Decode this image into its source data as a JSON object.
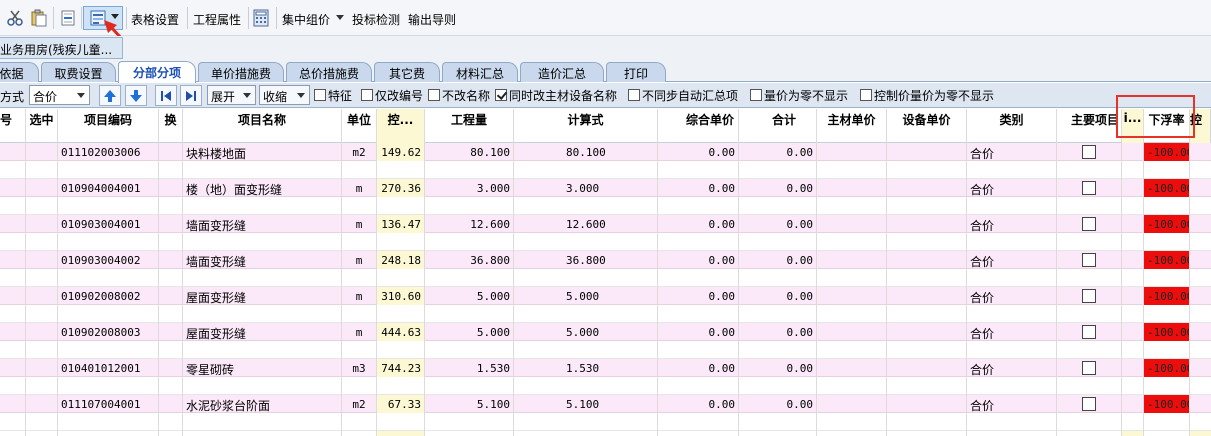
{
  "toolbar": {
    "buttons": [
      {
        "icon": "scissors-icon"
      },
      {
        "icon": "paste-icon"
      },
      {
        "icon": "insert-row-icon"
      },
      {
        "icon": "settings-panel-icon"
      }
    ],
    "table_settings": "表格设置",
    "project_attributes": "工程属性",
    "calculator_icon": "calculator-icon",
    "group_pricing": "集中组价",
    "bid_check": "投标检测",
    "export_wizard": "输出导则"
  },
  "file_tab": {
    "label": "业务用房(残疾儿童..."
  },
  "tabs": [
    {
      "label": "依据"
    },
    {
      "label": "取费设置"
    },
    {
      "label": "分部分项",
      "active": true
    },
    {
      "label": "单价措施费"
    },
    {
      "label": "总价措施费"
    },
    {
      "label": "其它费"
    },
    {
      "label": "材料汇总"
    },
    {
      "label": "造价汇总"
    },
    {
      "label": "打印"
    }
  ],
  "toolbar2": {
    "mode_label": "方式",
    "mode_value": "合价",
    "expand": "展开",
    "collapse": "收缩",
    "checkboxes": [
      {
        "label": "特征",
        "checked": false
      },
      {
        "label": "仅改编号",
        "checked": false
      },
      {
        "label": "不改名称",
        "checked": false
      },
      {
        "label": "同时改主材设备名称",
        "checked": true
      },
      {
        "label": "不同步自动汇总项",
        "checked": false
      },
      {
        "label": "量价为零不显示",
        "checked": false
      },
      {
        "label": "控制价量价为零不显示",
        "checked": false
      }
    ]
  },
  "grid": {
    "columns": [
      "号",
      "选中",
      "项目编码",
      "换",
      "项目名称",
      "单位",
      "控...",
      "工程量",
      "计算式",
      "综合单价",
      "合计",
      "主材单价",
      "设备单价",
      "类别",
      "主要项目",
      "i...",
      "下浮率",
      "控"
    ],
    "rows": [
      {
        "code": "011102003006",
        "name": "块料楼地面",
        "unit": "m2",
        "ctrl": "149.62",
        "qty": "80.100",
        "formula": "80.100",
        "unit_price": "0.00",
        "total": "0.00",
        "category": "合价",
        "rate": "-100.00"
      },
      {
        "code": "010904004001",
        "name": "楼（地）面变形缝",
        "unit": "m",
        "ctrl": "270.36",
        "qty": "3.000",
        "formula": "3.000",
        "unit_price": "0.00",
        "total": "0.00",
        "category": "合价",
        "rate": "-100.00"
      },
      {
        "code": "010903004001",
        "name": "墙面变形缝",
        "unit": "m",
        "ctrl": "136.47",
        "qty": "12.600",
        "formula": "12.600",
        "unit_price": "0.00",
        "total": "0.00",
        "category": "合价",
        "rate": "-100.00"
      },
      {
        "code": "010903004002",
        "name": "墙面变形缝",
        "unit": "m",
        "ctrl": "248.18",
        "qty": "36.800",
        "formula": "36.800",
        "unit_price": "0.00",
        "total": "0.00",
        "category": "合价",
        "rate": "-100.00"
      },
      {
        "code": "010902008002",
        "name": "屋面变形缝",
        "unit": "m",
        "ctrl": "310.60",
        "qty": "5.000",
        "formula": "5.000",
        "unit_price": "0.00",
        "total": "0.00",
        "category": "合价",
        "rate": "-100.00"
      },
      {
        "code": "010902008003",
        "name": "屋面变形缝",
        "unit": "m",
        "ctrl": "444.63",
        "qty": "5.000",
        "formula": "5.000",
        "unit_price": "0.00",
        "total": "0.00",
        "category": "合价",
        "rate": "-100.00"
      },
      {
        "code": "010401012001",
        "name": "零星砌砖",
        "unit": "m3",
        "ctrl": "744.23",
        "qty": "1.530",
        "formula": "1.530",
        "unit_price": "0.00",
        "total": "0.00",
        "category": "合价",
        "rate": "-100.00"
      },
      {
        "code": "011107004001",
        "name": "水泥砂浆台阶面",
        "unit": "m2",
        "ctrl": "67.33",
        "qty": "5.100",
        "formula": "5.100",
        "unit_price": "0.00",
        "total": "0.00",
        "category": "合价",
        "rate": "-100.00"
      }
    ]
  },
  "colors": {
    "row_pink": "#fbe9fa",
    "control_column": "#fbf8d3",
    "rate_red": "#ee0d0d",
    "highlight_box": "#e5332a",
    "active_tab_text": "#1a4fb5"
  }
}
